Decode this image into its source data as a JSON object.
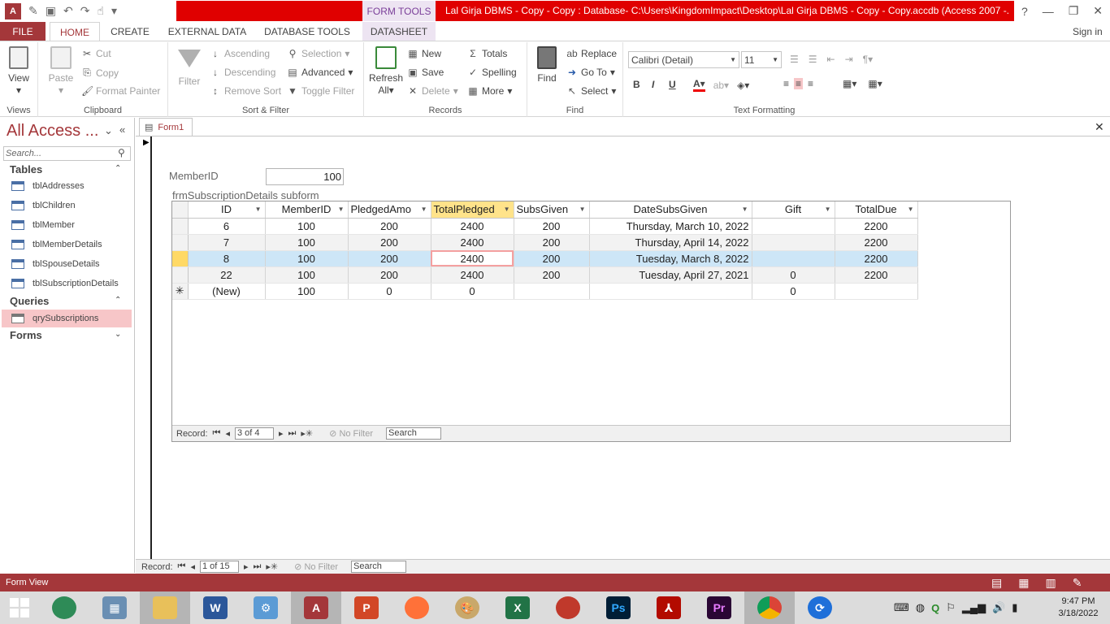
{
  "window": {
    "title": "Lal Girja DBMS - Copy - Copy : Database- C:\\Users\\KingdomImpact\\Desktop\\Lal Girja DBMS - Copy - Copy.accdb (Access 2007 -...",
    "context_tab": "FORM TOOLS",
    "controls": [
      "?",
      "—",
      "❐",
      "✕"
    ]
  },
  "ribbon_tabs": [
    "FILE",
    "HOME",
    "CREATE",
    "EXTERNAL DATA",
    "DATABASE TOOLS",
    "DATASHEET"
  ],
  "sign_in": "Sign in",
  "groups": {
    "views": {
      "label": "Views",
      "view": "View"
    },
    "clipboard": {
      "label": "Clipboard",
      "paste": "Paste",
      "cut": "Cut",
      "copy": "Copy",
      "format_painter": "Format Painter"
    },
    "sort_filter": {
      "label": "Sort & Filter",
      "filter": "Filter",
      "ascending": "Ascending",
      "descending": "Descending",
      "remove_sort": "Remove Sort",
      "selection": "Selection",
      "advanced": "Advanced",
      "toggle_filter": "Toggle Filter"
    },
    "records": {
      "label": "Records",
      "refresh": "Refresh",
      "refresh_all": "All",
      "new": "New",
      "save": "Save",
      "delete": "Delete",
      "totals": "Totals",
      "spelling": "Spelling",
      "more": "More"
    },
    "find": {
      "label": "Find",
      "find": "Find",
      "replace": "Replace",
      "goto": "Go To",
      "select": "Select"
    },
    "text_formatting": {
      "label": "Text Formatting",
      "font": "Calibri (Detail)",
      "size": "11",
      "bold": "B",
      "italic": "I",
      "underline": "U"
    }
  },
  "nav_pane": {
    "title": "All Access ...",
    "search_placeholder": "Search...",
    "sections": [
      {
        "name": "Tables",
        "items": [
          "tblAddresses",
          "tblChildren",
          "tblMember",
          "tblMemberDetails",
          "tblSpouseDetails",
          "tblSubscriptionDetails"
        ]
      },
      {
        "name": "Queries",
        "items": [
          "qrySubscriptions"
        ]
      },
      {
        "name": "Forms",
        "items": []
      }
    ]
  },
  "document_tab": "Form1",
  "form": {
    "member_label": "MemberID",
    "member_value": "100",
    "subform_label": "frmSubscriptionDetails subform"
  },
  "grid": {
    "columns": [
      "ID",
      "MemberID",
      "PledgedAmo",
      "TotalPledged",
      "SubsGiven",
      "DateSubsGiven",
      "Gift",
      "TotalDue"
    ],
    "rows": [
      [
        "6",
        "100",
        "200",
        "2400",
        "200",
        "Thursday, March 10, 2022",
        "",
        "2200"
      ],
      [
        "7",
        "100",
        "200",
        "2400",
        "200",
        "Thursday, April 14, 2022",
        "",
        "2200"
      ],
      [
        "8",
        "100",
        "200",
        "2400",
        "200",
        "Tuesday, March 8, 2022",
        "",
        "2200"
      ],
      [
        "22",
        "100",
        "200",
        "2400",
        "200",
        "Tuesday, April 27, 2021",
        "0",
        "2200"
      ],
      [
        "(New)",
        "100",
        "0",
        "0",
        "",
        "",
        "0",
        ""
      ]
    ],
    "new_row_marker": "✳"
  },
  "subform_nav": {
    "label": "Record:",
    "position": "3 of 4",
    "filter": "No Filter",
    "search": "Search"
  },
  "main_nav": {
    "label": "Record:",
    "position": "1 of 15",
    "filter": "No Filter",
    "search": "Search"
  },
  "status": {
    "text": "Form View"
  },
  "clock": {
    "time": "9:47 PM",
    "date": "3/18/2022"
  }
}
